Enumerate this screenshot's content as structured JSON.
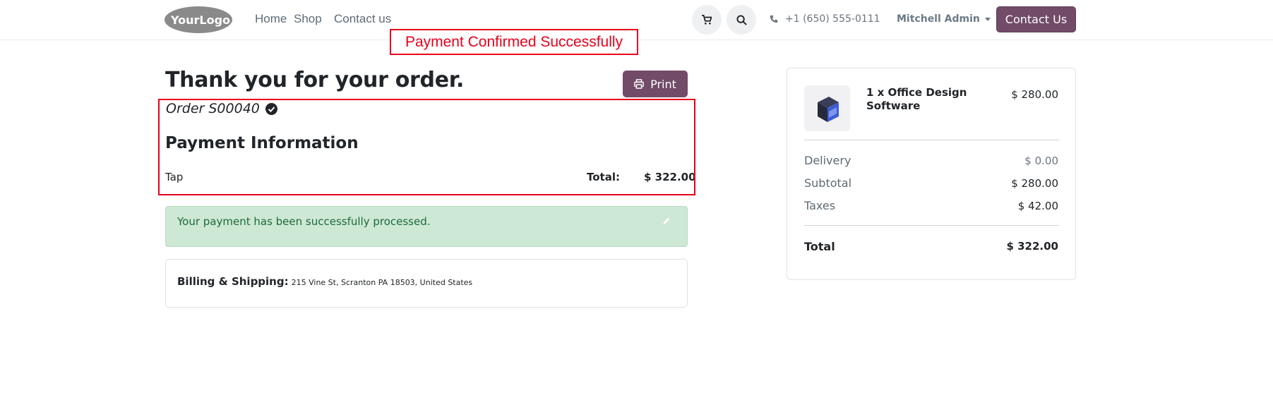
{
  "header": {
    "logo_text": "YourLogo",
    "nav": [
      "Home",
      "Shop",
      "Contact us"
    ],
    "phone": "+1 (650) 555-0111",
    "user": "Mitchell Admin",
    "contact_button": "Contact Us"
  },
  "annotation": {
    "banner": "Payment Confirmed Successfully"
  },
  "main": {
    "title": "Thank you for your order.",
    "print_button": "Print",
    "order_number": "Order S00040",
    "payment_title": "Payment Information",
    "payment_method": "Tap",
    "total_label": "Total:",
    "total_value": "$ 322.00",
    "alert": "Your payment has been successfully processed.",
    "billing_label": "Billing & Shipping:",
    "billing_address": "215 Vine St, Scranton PA 18503, United States"
  },
  "summary": {
    "product_name": "1 x Office Design Software",
    "product_price": "$ 280.00",
    "rows": [
      {
        "label": "Delivery",
        "value": "$ 0.00"
      },
      {
        "label": "Subtotal",
        "value": "$ 280.00"
      },
      {
        "label": "Taxes",
        "value": "$ 42.00"
      }
    ],
    "total_label": "Total",
    "total_value": "$ 322.00"
  },
  "colors": {
    "brand": "#714b67",
    "annotation": "#e8001c",
    "success_bg": "#cde8d5",
    "success_text": "#1c6a3a"
  },
  "icons": [
    "cart-icon",
    "search-icon",
    "phone-icon",
    "print-icon",
    "check-circle-icon",
    "pencil-icon",
    "product-box-icon"
  ]
}
